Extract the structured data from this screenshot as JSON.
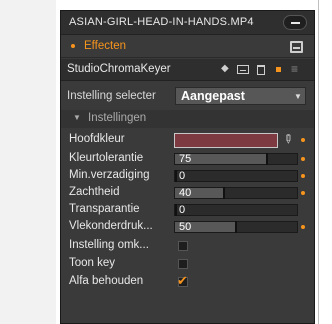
{
  "title": "ASIAN-GIRL-HEAD-IN-HANDS.MP4",
  "effects_label": "Effecten",
  "effect_name": "StudioChromaKeyer",
  "preset": {
    "label": "Instelling selecter",
    "value": "Aangepast"
  },
  "section_label": "Instellingen",
  "params": {
    "key_color": {
      "label": "Hoofdkleur",
      "color": "#7d3a40"
    },
    "color_tolerance": {
      "label": "Kleurtolerantie",
      "value": "75",
      "fraction": 0.75
    },
    "saturation_min": {
      "label": "Min.verzadiging",
      "value": "0",
      "fraction": 0.0
    },
    "softness": {
      "label": "Zachtheid",
      "value": "40",
      "fraction": 0.4
    },
    "transparency": {
      "label": "Transparantie",
      "value": "0",
      "fraction": 0.0
    },
    "spot_suppression": {
      "label": "Vlekonderdruk...",
      "value": "50",
      "fraction": 0.5
    },
    "invert_setting": {
      "label": "Instelling omk...",
      "checked": false
    },
    "show_key": {
      "label": "Toon key",
      "checked": false
    },
    "keep_alpha": {
      "label": "Alfa behouden",
      "checked": true
    }
  },
  "colors": {
    "accent": "#f7941d",
    "panel": "#3a3a3a"
  },
  "icons": [
    "minimize-icon",
    "save-icon",
    "diamond-icon",
    "monitor-icon",
    "trash-icon",
    "menu-icon",
    "eyedropper-icon",
    "dropdown-arrow-icon",
    "collapse-triangle-icon",
    "checkmark-icon"
  ]
}
